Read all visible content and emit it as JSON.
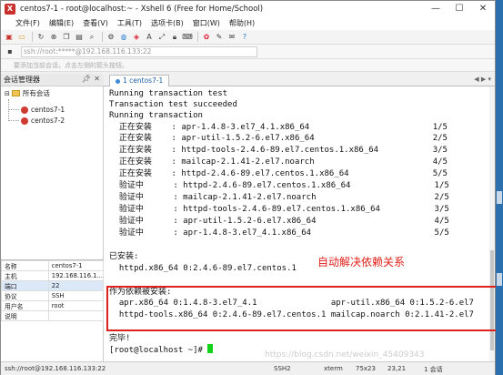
{
  "window": {
    "title": "centos7-1 - root@localhost:~ - Xshell 6 (Free for Home/School)"
  },
  "menu": [
    "文件(F)",
    "编辑(E)",
    "查看(V)",
    "工具(T)",
    "选项卡(B)",
    "窗口(W)",
    "帮助(H)"
  ],
  "address": {
    "placeholder": "ssh://root:*****@192.168.116.133:22"
  },
  "infobar_text": "要添加当前会话，点击左侧的箭头按钮。",
  "session_manager": {
    "title": "会话管理器",
    "root": "所有会话",
    "items": [
      "centos7-1",
      "centos7-2"
    ]
  },
  "properties": [
    [
      "名称",
      "centos7-1"
    ],
    [
      "主机",
      "192.168.116.1..."
    ],
    [
      "端口",
      "22"
    ],
    [
      "协议",
      "SSH"
    ],
    [
      "用户名",
      "root"
    ],
    [
      "说明",
      ""
    ]
  ],
  "tab": {
    "label": "1 centos7-1"
  },
  "terminal": {
    "lines": [
      "Running transaction test",
      "Transaction test succeeded",
      "Running transaction",
      "  正在安装    : apr-1.4.8-3.el7_4.1.x86_64                         1/5",
      "  正在安装    : apr-util-1.5.2-6.el7.x86_64                        2/5",
      "  正在安装    : httpd-tools-2.4.6-89.el7.centos.1.x86_64           3/5",
      "  正在安装    : mailcap-2.1.41-2.el7.noarch                        4/5",
      "  正在安装    : httpd-2.4.6-89.el7.centos.1.x86_64                 5/5",
      "  验证中      : httpd-2.4.6-89.el7.centos.1.x86_64                 1/5",
      "  验证中      : mailcap-2.1.41-2.el7.noarch                        2/5",
      "  验证中      : httpd-tools-2.4.6-89.el7.centos.1.x86_64           3/5",
      "  验证中      : apr-util-1.5.2-6.el7.x86_64                        4/5",
      "  验证中      : apr-1.4.8-3.el7_4.1.x86_64                         5/5",
      "",
      "已安装:",
      "  httpd.x86_64 0:2.4.6-89.el7.centos.1",
      "",
      "作为依赖被安装:",
      "  apr.x86_64 0:1.4.8-3.el7_4.1               apr-util.x86_64 0:1.5.2-6.el7",
      "  httpd-tools.x86_64 0:2.4.6-89.el7.centos.1 mailcap.noarch 0:2.1.41-2.el7",
      "",
      "完毕!",
      "[root@localhost ~]# "
    ],
    "annotation": "自动解决依赖关系"
  },
  "statusbar": {
    "address": "ssh://root@192.168.116.133:22",
    "protocol": "SSH2",
    "term": "xterm",
    "size": "75x23",
    "pos": "23,21",
    "sessions": "1 会话",
    "watermark": "https://blog.csdn.net/weixin_45409343"
  }
}
